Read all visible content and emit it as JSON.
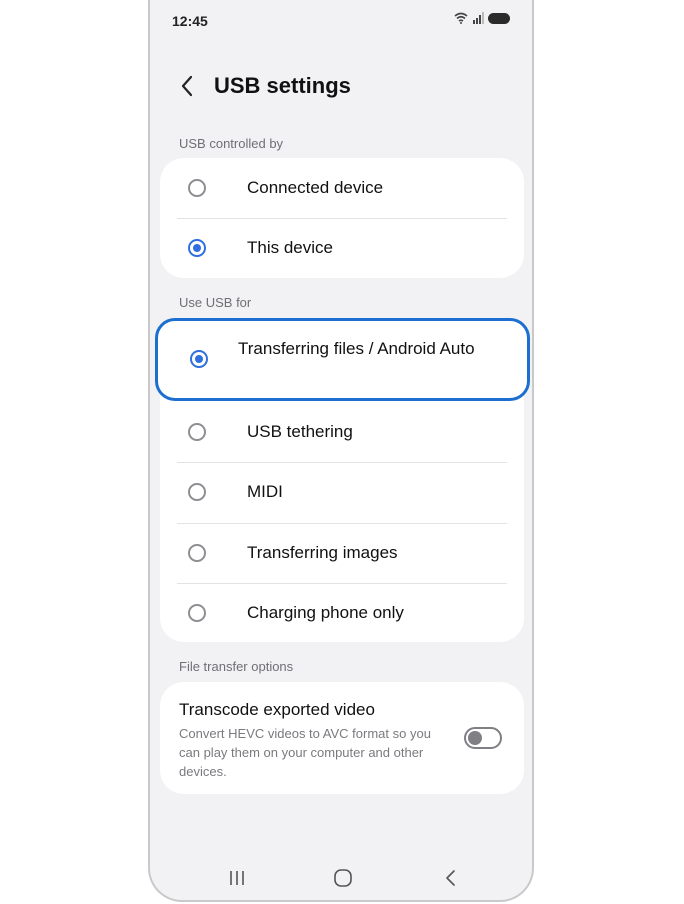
{
  "status_bar": {
    "time": "12:45"
  },
  "header": {
    "title": "USB settings"
  },
  "sections": {
    "controlled_by": {
      "label": "USB controlled by",
      "options": [
        {
          "label": "Connected device",
          "checked": false
        },
        {
          "label": "This device",
          "checked": true
        }
      ]
    },
    "use_for": {
      "label": "Use USB for",
      "options": [
        {
          "label": "Transferring files / Android Auto",
          "checked": true
        },
        {
          "label": "USB tethering",
          "checked": false
        },
        {
          "label": "MIDI",
          "checked": false
        },
        {
          "label": "Transferring images",
          "checked": false
        },
        {
          "label": "Charging phone only",
          "checked": false
        }
      ]
    },
    "file_transfer": {
      "label": "File transfer options",
      "transcode": {
        "title": "Transcode exported video",
        "description": "Convert HEVC videos to AVC format so you can play them on your computer and other devices.",
        "enabled": false
      }
    }
  },
  "colors": {
    "accent": "#2f6fe0",
    "highlight": "#1c6fd0",
    "background": "#f2f2f4"
  }
}
